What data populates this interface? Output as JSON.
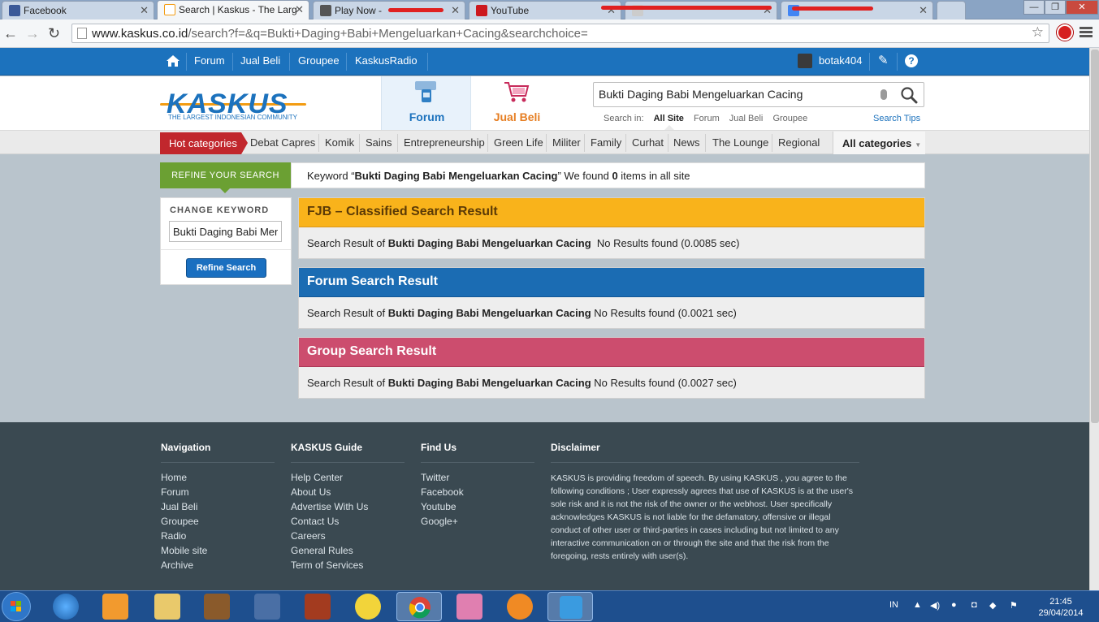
{
  "browser": {
    "tabs": [
      {
        "label": "Facebook",
        "color": "#3b5998"
      },
      {
        "label": "Search | Kaskus - The Larg",
        "color": "#f39c12"
      },
      {
        "label": "Play Now - ",
        "color": "#555555"
      },
      {
        "label": "YouTube",
        "color": "#cc181e"
      },
      {
        "label": "",
        "color": "#cccccc"
      },
      {
        "label": "",
        "color": "#4285f4"
      }
    ],
    "url_host": "www.kaskus.co.id",
    "url_path": "/search?f=&q=Bukti+Daging+Babi+Mengeluarkan+Cacing&searchchoice="
  },
  "topnav": {
    "items": [
      "Forum",
      "Jual Beli",
      "Groupee",
      "KaskusRadio"
    ],
    "username": "botak404"
  },
  "header": {
    "logo_text": "KASKUS",
    "logo_tagline": "THE LARGEST INDONESIAN COMMUNITY",
    "tab_forum": "Forum",
    "tab_jualbeli": "Jual Beli",
    "search_value": "Bukti Daging Babi Mengeluarkan Cacing",
    "search_in_label": "Search in:",
    "search_in_options": [
      "All Site",
      "Forum",
      "Jual Beli",
      "Groupee"
    ],
    "search_tips": "Search Tips"
  },
  "categories": {
    "hot": "Hot categories",
    "items": [
      "Debat Capres",
      "Komik",
      "Sains",
      "Entrepreneurship",
      "Green Life",
      "Militer",
      "Family",
      "Curhat",
      "News",
      "The Lounge",
      "Regional"
    ],
    "all": "All categories"
  },
  "refine": {
    "title": "REFINE YOUR SEARCH",
    "change_keyword": "CHANGE KEYWORD",
    "keyword_value": "Bukti Daging Babi Mengeluarkan Cacing",
    "button": "Refine Search"
  },
  "summary": {
    "prefix": "Keyword “",
    "keyword": "Bukti Daging Babi Mengeluarkan Cacing",
    "middle": "” We found ",
    "count": "0",
    "suffix": " items in all site"
  },
  "results": [
    {
      "title": "FJB – Classified Search Result",
      "prefix": "Search Result of ",
      "keyword": "Bukti Daging Babi Mengeluarkan Cacing",
      "status": "  No Results found (0.0085 sec)"
    },
    {
      "title": "Forum Search Result",
      "prefix": "Search Result of ",
      "keyword": "Bukti Daging Babi Mengeluarkan Cacing",
      "status": " No Results found (0.0021 sec)"
    },
    {
      "title": "Group Search Result",
      "prefix": "Search Result of ",
      "keyword": "Bukti Daging Babi Mengeluarkan Cacing",
      "status": " No Results found (0.0027 sec)"
    }
  ],
  "footer": {
    "navigation": {
      "title": "Navigation",
      "links": [
        "Home",
        "Forum",
        "Jual Beli",
        "Groupee",
        "Radio",
        "Mobile site",
        "Archive"
      ]
    },
    "guide": {
      "title": "KASKUS Guide",
      "links": [
        "Help Center",
        "About Us",
        "Advertise With Us",
        "Contact Us",
        "Careers",
        "General Rules",
        "Term of Services"
      ]
    },
    "findus": {
      "title": "Find Us",
      "links": [
        "Twitter",
        "Facebook",
        "Youtube",
        "Google+"
      ]
    },
    "disclaimer": {
      "title": "Disclaimer",
      "text": "KASKUS is providing freedom of speech. By using KASKUS , you agree to the following conditions ; User expressly agrees that use of KASKUS is at the user's sole risk and it is not the risk of the owner or the webhost. User specifically acknowledges KASKUS is not liable for the defamatory, offensive or illegal conduct of other user or third-parties in cases including but not limited to any interactive communication on or through the site and that the risk from the foregoing, rests entirely with user(s)."
    }
  },
  "taskbar": {
    "lang": "IN",
    "time": "21:45",
    "date": "29/04/2014"
  }
}
